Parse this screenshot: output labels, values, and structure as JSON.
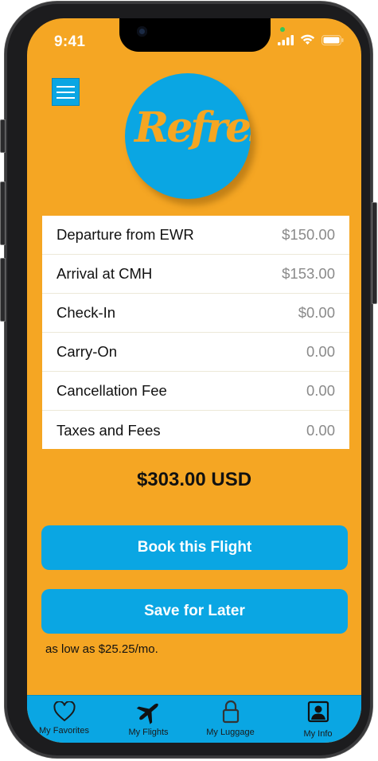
{
  "status_bar": {
    "time": "9:41"
  },
  "app": {
    "logo_text": "Refresh"
  },
  "fare_breakdown": [
    {
      "label": "Departure  from EWR",
      "value": "$150.00"
    },
    {
      "label": "Arrival  at CMH",
      "value": "$153.00"
    },
    {
      "label": "Check-In",
      "value": "$0.00"
    },
    {
      "label": "Carry-On",
      "value": "0.00"
    },
    {
      "label": "Cancellation Fee",
      "value": "0.00"
    },
    {
      "label": "Taxes and Fees",
      "value": "0.00"
    }
  ],
  "total": "$303.00 USD",
  "actions": {
    "book_label": "Book this Flight",
    "save_label": "Save for Later"
  },
  "financing_text": "as low as $25.25/mo.",
  "tabs": [
    {
      "label": "My Favorites",
      "icon": "heart-icon"
    },
    {
      "label": "My Flights",
      "icon": "airplane-icon"
    },
    {
      "label": "My Luggage",
      "icon": "lock-icon"
    },
    {
      "label": "My Info",
      "icon": "person-icon"
    }
  ],
  "colors": {
    "background": "#f5a623",
    "accent": "#0aa6e3",
    "card": "#ffffff"
  }
}
